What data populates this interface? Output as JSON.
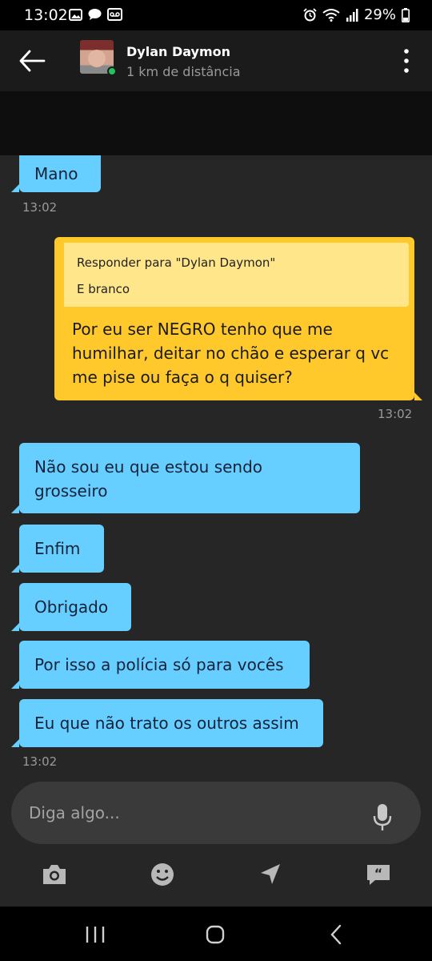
{
  "status_bar": {
    "time": "13:02",
    "battery": "29%",
    "left_icons": [
      "image-icon",
      "chat-bubble-icon",
      "voicemail-icon"
    ],
    "right_icons": [
      "alarm-icon",
      "wifi-icon",
      "signal-icon",
      "battery-icon"
    ]
  },
  "header": {
    "contact_name": "Dylan Daymon",
    "distance": "1 km de distância",
    "online": true
  },
  "messages": [
    {
      "side": "in",
      "text": "Mano"
    },
    {
      "side": "in_time",
      "text": "13:02"
    },
    {
      "side": "out",
      "reply_to": "Responder para \"Dylan Daymon\"",
      "quoted": "E branco",
      "text": "Por eu ser NEGRO tenho que me humilhar, deitar no chão e esperar q vc me pise ou faça o q quiser?",
      "time": "13:02"
    },
    {
      "side": "in",
      "text": "Não sou eu que estou sendo grosseiro"
    },
    {
      "side": "in",
      "text": "Enfim"
    },
    {
      "side": "in",
      "text": "Obrigado"
    },
    {
      "side": "in",
      "text": "Por isso a polícia só para vocês"
    },
    {
      "side": "in",
      "text": "Eu que não trato os outros assim"
    },
    {
      "side": "in_time",
      "text": "13:02"
    }
  ],
  "composer": {
    "placeholder": "Diga algo..."
  },
  "actions": [
    "camera-icon",
    "emoji-icon",
    "location-icon",
    "quick-replies-icon"
  ],
  "colors": {
    "incoming_bubble": "#66cfff",
    "outgoing_bubble": "#ffc82b",
    "quote_background": "#ffe68a",
    "chat_background": "#262626",
    "header_background": "#1b1b1b",
    "online_dot": "#22c35a"
  }
}
